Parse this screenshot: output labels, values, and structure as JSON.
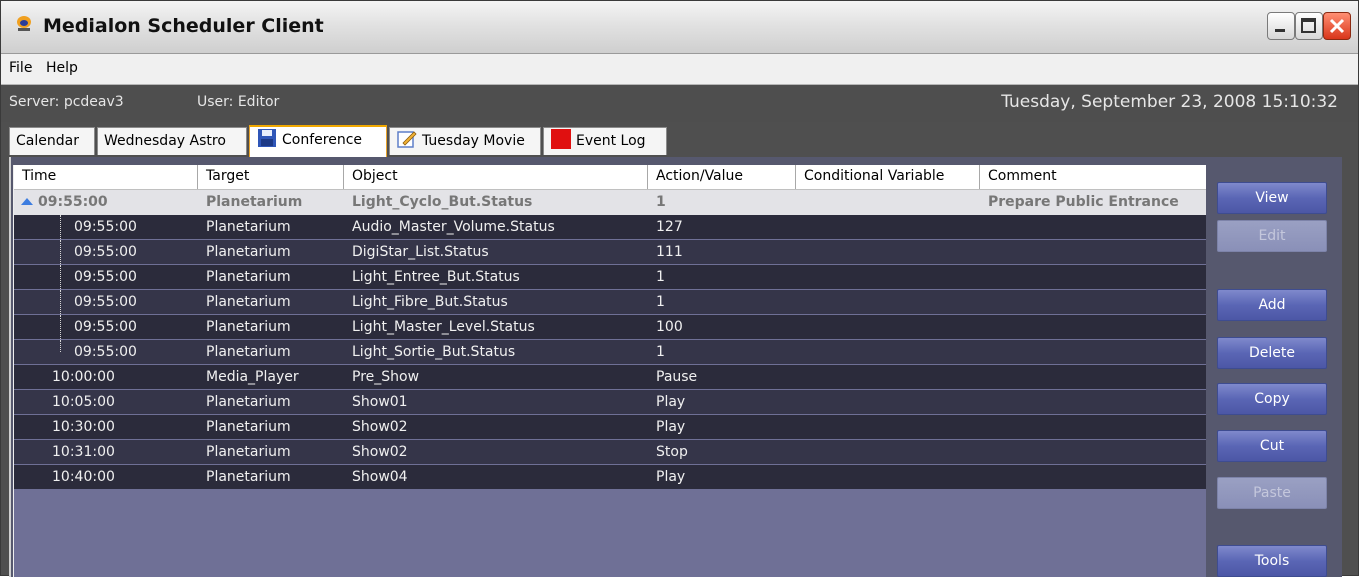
{
  "window": {
    "title": "Medialon Scheduler Client",
    "brand_color": "#5a66b5"
  },
  "menu": [
    "File",
    "Help"
  ],
  "status": {
    "server": "Server: pcdeav3",
    "user": "User: Editor",
    "datetime": "Tuesday, September 23, 2008 15:10:32"
  },
  "tabs": [
    {
      "label": "Calendar",
      "icon": ""
    },
    {
      "label": "Wednesday Astro",
      "icon": ""
    },
    {
      "label": "Conference",
      "icon": "floppy-disk-icon",
      "active": true
    },
    {
      "label": "Tuesday Movie",
      "icon": "edit-note-icon"
    },
    {
      "label": "Event Log",
      "icon": "red-square-icon"
    }
  ],
  "table": {
    "columns": [
      "Time",
      "Target",
      "Object",
      "Action/Value",
      "Conditional Variable",
      "Comment"
    ],
    "parent_row": {
      "time": "09:55:00",
      "target": "Planetarium",
      "object": "Light_Cyclo_But.Status",
      "value": "1",
      "cond": "",
      "comment": "Prepare Public Entrance"
    },
    "child_rows": [
      {
        "time": "09:55:00",
        "target": "Planetarium",
        "object": "Audio_Master_Volume.Status",
        "value": "127",
        "cond": "",
        "comment": ""
      },
      {
        "time": "09:55:00",
        "target": "Planetarium",
        "object": "DigiStar_List.Status",
        "value": "111",
        "cond": "",
        "comment": ""
      },
      {
        "time": "09:55:00",
        "target": "Planetarium",
        "object": "Light_Entree_But.Status",
        "value": "1",
        "cond": "",
        "comment": ""
      },
      {
        "time": "09:55:00",
        "target": "Planetarium",
        "object": "Light_Fibre_But.Status",
        "value": "1",
        "cond": "",
        "comment": ""
      },
      {
        "time": "09:55:00",
        "target": "Planetarium",
        "object": "Light_Master_Level.Status",
        "value": "100",
        "cond": "",
        "comment": ""
      },
      {
        "time": "09:55:00",
        "target": "Planetarium",
        "object": "Light_Sortie_But.Status",
        "value": "1",
        "cond": "",
        "comment": ""
      }
    ],
    "rows": [
      {
        "time": "10:00:00",
        "target": "Media_Player",
        "object": "Pre_Show",
        "value": "Pause",
        "cond": "",
        "comment": ""
      },
      {
        "time": "10:05:00",
        "target": "Planetarium",
        "object": "Show01",
        "value": "Play",
        "cond": "",
        "comment": ""
      },
      {
        "time": "10:30:00",
        "target": "Planetarium",
        "object": "Show02",
        "value": "Play",
        "cond": "",
        "comment": ""
      },
      {
        "time": "10:31:00",
        "target": "Planetarium",
        "object": "Show02",
        "value": "Stop",
        "cond": "",
        "comment": ""
      },
      {
        "time": "10:40:00",
        "target": "Planetarium",
        "object": "Show04",
        "value": "Play",
        "cond": "",
        "comment": ""
      }
    ]
  },
  "buttons": {
    "view": "View",
    "edit": "Edit",
    "add": "Add",
    "delete": "Delete",
    "copy": "Copy",
    "cut": "Cut",
    "paste": "Paste",
    "tools": "Tools"
  }
}
